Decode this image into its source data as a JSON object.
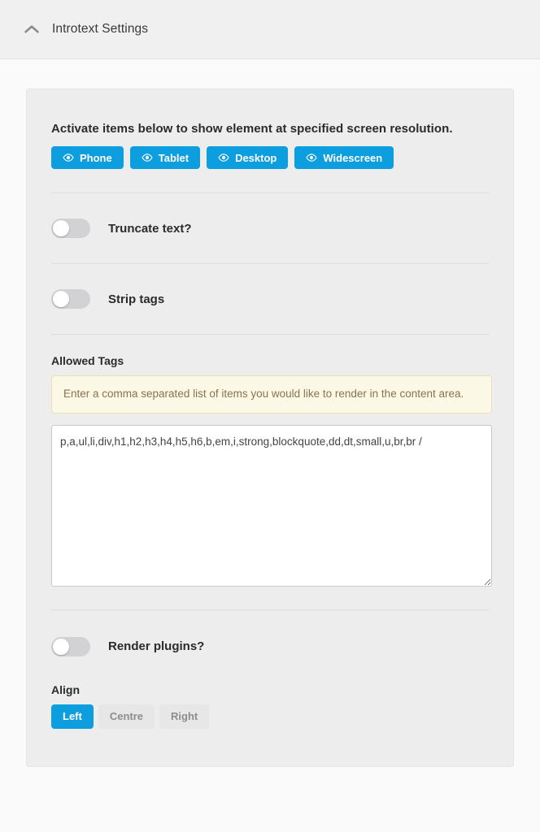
{
  "header": {
    "title": "Introtext Settings",
    "collapse_icon": "chevron-up-icon"
  },
  "main": {
    "resolution_section": {
      "instruction": "Activate items below to show element at specified screen resolution.",
      "buttons": [
        {
          "label": "Phone",
          "icon": "eye-icon",
          "active": true,
          "color": "#0d9ee0"
        },
        {
          "label": "Tablet",
          "icon": "eye-icon",
          "active": true,
          "color": "#0d9ee0"
        },
        {
          "label": "Desktop",
          "icon": "eye-icon",
          "active": true,
          "color": "#0d9ee0"
        },
        {
          "label": "Widescreen",
          "icon": "eye-icon",
          "active": true,
          "color": "#0d9ee0"
        }
      ]
    },
    "toggles": [
      {
        "label": "Truncate text?",
        "state": "off"
      },
      {
        "label": "Strip tags",
        "state": "off"
      },
      {
        "label": "Render plugins?",
        "state": "off"
      }
    ],
    "allowed_tags": {
      "label": "Allowed Tags",
      "help": "Enter a comma separated list of items you would like to render in the content area.",
      "value": "p,a,ul,li,div,h1,h2,h3,h4,h5,h6,b,em,i,strong,blockquote,dd,dt,small,u,br,br /",
      "placeholder": ""
    },
    "align": {
      "label": "Align",
      "selected": "Left",
      "options": [
        {
          "label": "Left",
          "active": true
        },
        {
          "label": "Centre",
          "active": false
        },
        {
          "label": "Right",
          "active": false
        }
      ]
    }
  },
  "colors": {
    "accent": "#0d9ee0",
    "card_bg": "#ededed",
    "page_bg": "#fafafa",
    "header_bg": "#f0f0f0",
    "help_bg": "#fcf8e6",
    "help_border": "#ecdfb6",
    "help_text": "#8a7350",
    "toggle_track": "#d2d2d5",
    "divider": "#dcdcdc"
  }
}
